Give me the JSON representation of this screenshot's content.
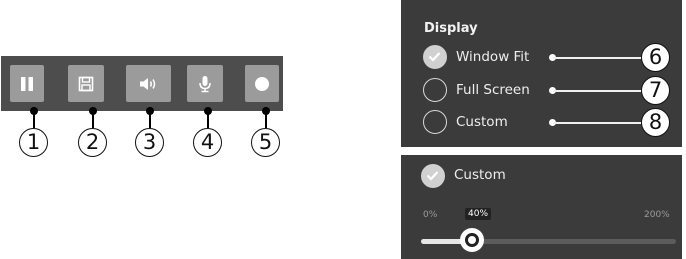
{
  "toolbar": {
    "buttons": [
      {
        "icon": "pause-icon",
        "callout": "1"
      },
      {
        "icon": "save-icon",
        "callout": "2"
      },
      {
        "icon": "speaker-icon",
        "callout": "3"
      },
      {
        "icon": "microphone-icon",
        "callout": "4"
      },
      {
        "icon": "record-icon",
        "callout": "5"
      }
    ]
  },
  "display": {
    "title": "Display",
    "options": [
      {
        "label": "Window Fit",
        "checked": true,
        "callout": "6"
      },
      {
        "label": "Full Screen",
        "checked": false,
        "callout": "7"
      },
      {
        "label": "Custom",
        "checked": false,
        "callout": "8"
      }
    ]
  },
  "custom": {
    "label": "Custom",
    "checked": true,
    "slider": {
      "min_label": "0%",
      "max_label": "200%",
      "value_label": "40%",
      "value": 40,
      "max": 200
    }
  },
  "colors": {
    "toolbar_bg": "#4d4d4d",
    "button_bg": "#9b9b9b",
    "panel_bg": "#3b3b3b",
    "text": "#eeeeee"
  }
}
